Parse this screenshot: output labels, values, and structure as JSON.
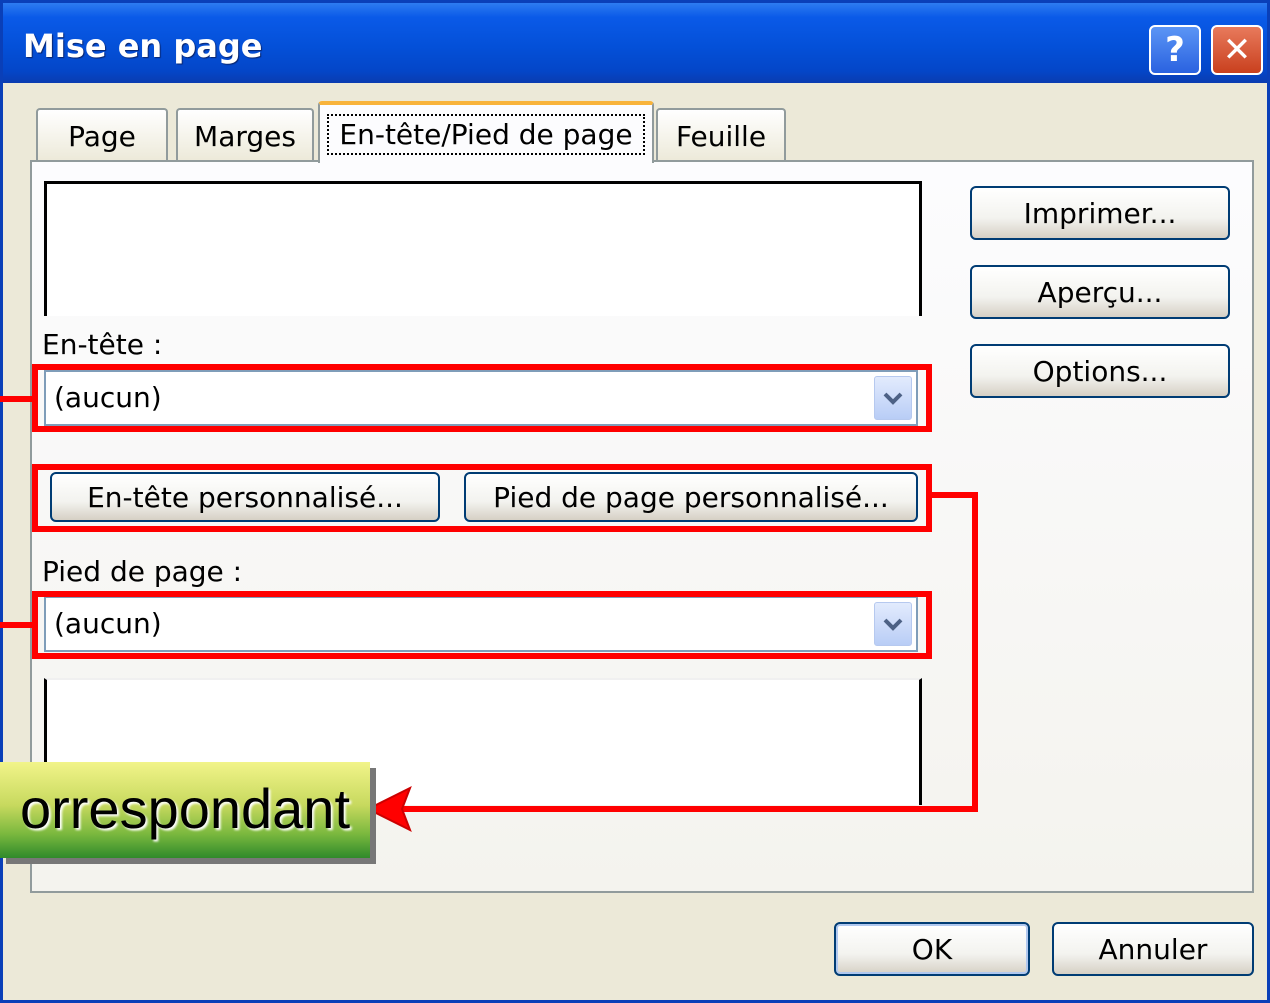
{
  "dialog": {
    "title": "Mise en page",
    "help_glyph": "?",
    "close_glyph": "✕"
  },
  "tabs": [
    {
      "label": "Page"
    },
    {
      "label": "Marges"
    },
    {
      "label": "En-tête/Pied de page",
      "active": true
    },
    {
      "label": "Feuille"
    }
  ],
  "header": {
    "label": "En-tête :",
    "value": "(aucun)"
  },
  "custom_buttons": {
    "header": "En-tête personnalisé...",
    "footer": "Pied de page personnalisé..."
  },
  "footer": {
    "label": "Pied de page :",
    "value": "(aucun)"
  },
  "side_buttons": {
    "print": "Imprimer...",
    "preview": "Aperçu...",
    "options": "Options..."
  },
  "bottom_buttons": {
    "ok": "OK",
    "cancel": "Annuler"
  },
  "annotation": {
    "callout_text": "orrespondant",
    "highlight_color": "#ff0000"
  }
}
